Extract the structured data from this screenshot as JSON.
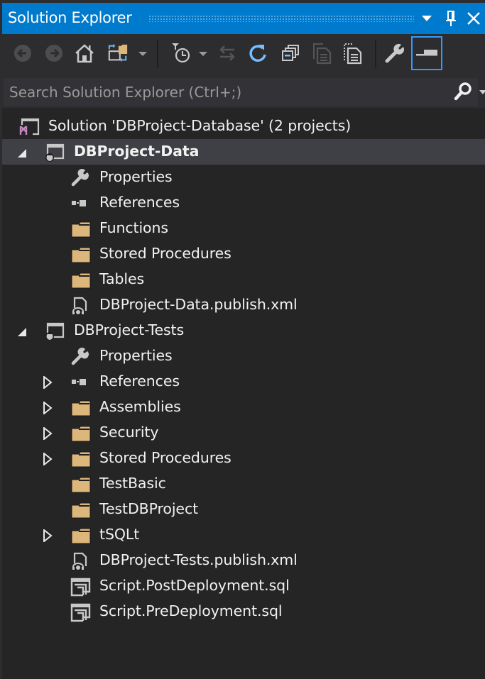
{
  "window": {
    "title": "Solution Explorer",
    "buttons": {
      "dropdown": "window-position-menu",
      "pin": "auto-hide",
      "close": "close"
    }
  },
  "toolbar": {
    "buttons": [
      {
        "name": "back-button",
        "icon": "arrow-left-circle-icon",
        "enabled": false
      },
      {
        "name": "forward-button",
        "icon": "arrow-right-circle-icon",
        "enabled": false
      },
      {
        "name": "home-button",
        "icon": "home-icon",
        "enabled": true
      },
      {
        "name": "switch-views-button",
        "icon": "switch-views-icon",
        "enabled": true,
        "dropdown": true
      },
      {
        "name": "pending-changes-filter-button",
        "icon": "clock-filter-icon",
        "enabled": true,
        "dropdown": true
      },
      {
        "name": "sync-with-active-document-button",
        "icon": "sync-arrows-icon",
        "enabled": false
      },
      {
        "name": "refresh-button",
        "icon": "refresh-icon",
        "enabled": true
      },
      {
        "name": "collapse-all-button",
        "icon": "collapse-all-icon",
        "enabled": true
      },
      {
        "name": "show-all-files-button",
        "icon": "copy-files-icon",
        "enabled": false
      },
      {
        "name": "show-all-files-dotted-button",
        "icon": "show-all-files-icon",
        "enabled": true
      },
      {
        "name": "properties-button",
        "icon": "wrench-icon",
        "enabled": true
      },
      {
        "name": "preview-selected-items-button",
        "icon": "preview-icon",
        "enabled": true,
        "selected": true
      }
    ]
  },
  "search": {
    "placeholder": "Search Solution Explorer (Ctrl+;)",
    "value": ""
  },
  "colors": {
    "accent": "#007acc",
    "background": "#252526",
    "toolbar": "#2d2d30",
    "selection": "#3f3f46",
    "folder": "#dcb67a",
    "vs_purple": "#c586c0",
    "refresh_blue": "#75beff"
  },
  "tree": [
    {
      "level": 0,
      "label": "Solution 'DBProject-Database' (2 projects)",
      "icon": "solution-icon",
      "expander": "none",
      "bold": false,
      "selected": false
    },
    {
      "level": 1,
      "label": "DBProject-Data",
      "icon": "db-project-icon",
      "expander": "expanded",
      "bold": true,
      "selected": true
    },
    {
      "level": 2,
      "label": "Properties",
      "icon": "wrench-icon",
      "expander": "none"
    },
    {
      "level": 2,
      "label": "References",
      "icon": "references-icon",
      "expander": "none"
    },
    {
      "level": 2,
      "label": "Functions",
      "icon": "folder-icon",
      "expander": "none"
    },
    {
      "level": 2,
      "label": "Stored Procedures",
      "icon": "folder-icon",
      "expander": "none"
    },
    {
      "level": 2,
      "label": "Tables",
      "icon": "folder-icon",
      "expander": "none"
    },
    {
      "level": 2,
      "label": "DBProject-Data.publish.xml",
      "icon": "publish-profile-icon",
      "expander": "none"
    },
    {
      "level": 1,
      "label": "DBProject-Tests",
      "icon": "db-project-icon",
      "expander": "expanded",
      "bold": false
    },
    {
      "level": 2,
      "label": "Properties",
      "icon": "wrench-icon",
      "expander": "none"
    },
    {
      "level": 2,
      "label": "References",
      "icon": "references-icon",
      "expander": "collapsed"
    },
    {
      "level": 2,
      "label": "Assemblies",
      "icon": "folder-icon",
      "expander": "collapsed"
    },
    {
      "level": 2,
      "label": "Security",
      "icon": "folder-icon",
      "expander": "collapsed"
    },
    {
      "level": 2,
      "label": "Stored Procedures",
      "icon": "folder-icon",
      "expander": "collapsed"
    },
    {
      "level": 2,
      "label": "TestBasic",
      "icon": "folder-icon",
      "expander": "none"
    },
    {
      "level": 2,
      "label": "TestDBProject",
      "icon": "folder-icon",
      "expander": "none"
    },
    {
      "level": 2,
      "label": "tSQLt",
      "icon": "folder-icon",
      "expander": "collapsed"
    },
    {
      "level": 2,
      "label": "DBProject-Tests.publish.xml",
      "icon": "publish-profile-icon",
      "expander": "none"
    },
    {
      "level": 2,
      "label": "Script.PostDeployment.sql",
      "icon": "sql-script-icon",
      "expander": "none"
    },
    {
      "level": 2,
      "label": "Script.PreDeployment.sql",
      "icon": "sql-script-icon",
      "expander": "none"
    }
  ]
}
